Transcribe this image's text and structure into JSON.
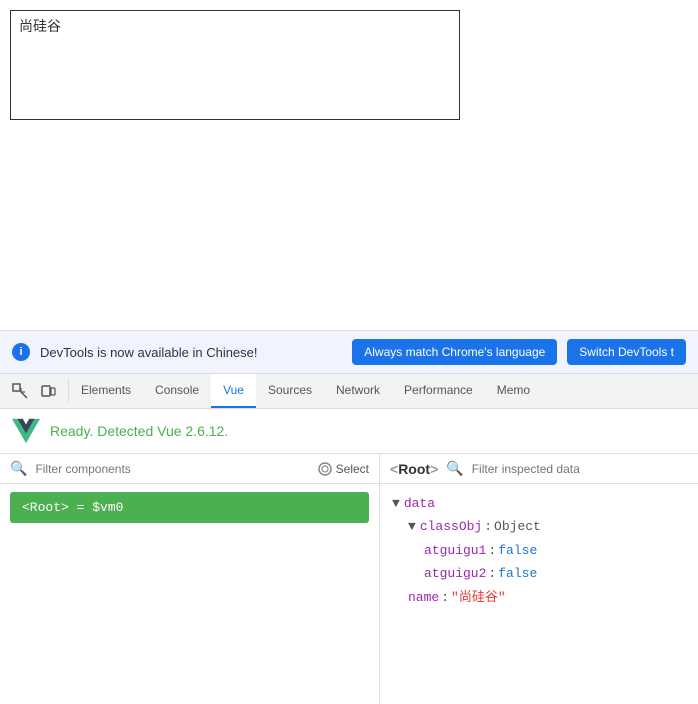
{
  "page": {
    "textbox_content": "尚硅谷"
  },
  "notification": {
    "info_icon": "i",
    "message": "DevTools is now available in Chinese!",
    "btn1_label": "Always match Chrome's language",
    "btn2_label": "Switch DevTools t"
  },
  "devtools": {
    "tabs": [
      {
        "id": "elements",
        "label": "Elements",
        "active": false
      },
      {
        "id": "console",
        "label": "Console",
        "active": false
      },
      {
        "id": "vue",
        "label": "Vue",
        "active": true
      },
      {
        "id": "sources",
        "label": "Sources",
        "active": false
      },
      {
        "id": "network",
        "label": "Network",
        "active": false
      },
      {
        "id": "performance",
        "label": "Performance",
        "active": false
      },
      {
        "id": "memo",
        "label": "Memo",
        "active": false
      }
    ]
  },
  "vue_panel": {
    "ready_text": "Ready. Detected Vue 2.6.12.",
    "left": {
      "filter_placeholder": "Filter components",
      "select_label": "Select",
      "root_item": "<Root> = $vm0"
    },
    "right": {
      "breadcrumb": "<Root>",
      "filter_placeholder": "Filter inspected data",
      "tree": {
        "data_key": "data",
        "classObj_key": "classObj",
        "classObj_type": "Object",
        "atguigu1_key": "atguigu1",
        "atguigu1_val": "false",
        "atguigu2_key": "atguigu2",
        "atguigu2_val": "false",
        "name_key": "name",
        "name_val": "\"尚硅谷\""
      }
    }
  }
}
